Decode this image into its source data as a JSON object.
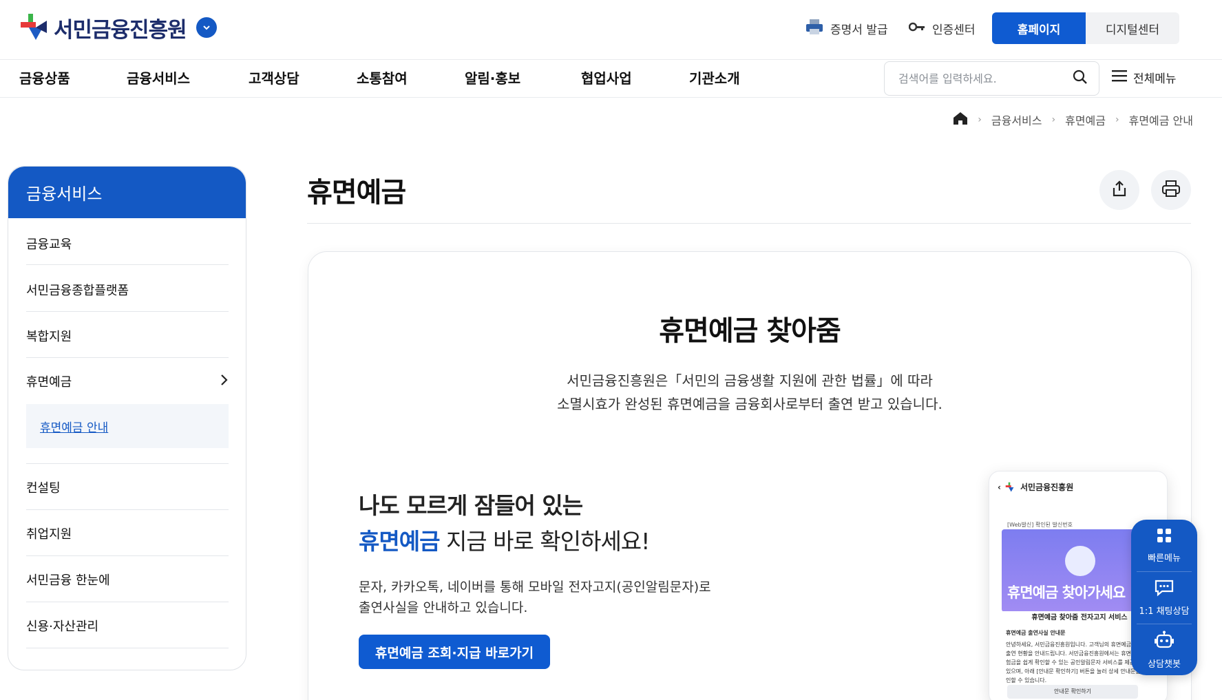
{
  "header": {
    "logo_text": "서민금융진흥원",
    "utilities": [
      {
        "label": "증명서 발급",
        "icon": "printer-icon"
      },
      {
        "label": "인증센터",
        "icon": "key-icon"
      }
    ],
    "home_button": "홈페이지",
    "digital_button": "디지털센터"
  },
  "nav": {
    "items": [
      "금융상품",
      "금융서비스",
      "고객상담",
      "소통참여",
      "알림·홍보",
      "협업사업",
      "기관소개"
    ],
    "search_placeholder": "검색어를 입력하세요.",
    "all_menu": "전체메뉴"
  },
  "breadcrumb": [
    "금융서비스",
    "휴면예금",
    "휴면예금 안내"
  ],
  "sidebar": {
    "title": "금융서비스",
    "items": [
      "금융교육",
      "서민금융종합플랫폼",
      "복합지원",
      "휴면예금",
      "컨설팅",
      "취업지원",
      "서민금융 한눈에",
      "신용·자산관리"
    ],
    "sub_item": "휴면예금 안내"
  },
  "main": {
    "title": "휴면예금",
    "hero_title": "휴면예금 찾아줌",
    "hero_desc_line1": "서민금융진흥원은「서민의 금융생활 지원에 관한 법률」에 따라",
    "hero_desc_line2": "소멸시효가 완성된 휴면예금을 금융회사로부터 출연 받고 있습니다.",
    "promo_line1": "나도 모르게 잠들어 있는",
    "promo_highlight": "휴면예금",
    "promo_line2_rest": " 지금 바로 확인하세요!",
    "promo_desc_line1": "문자, 카카오톡, 네이버를 통해 모바일 전자고지(공인알림문자)로",
    "promo_desc_line2": "출연사실을 안내하고 있습니다.",
    "cta": "휴면예금 조회·지급 바로가기"
  },
  "phone": {
    "app_title": "서민금융진흥원",
    "sub_label": "[Web발신] 확인된 발신번호",
    "banner_title": "휴면예금 찾아가세요",
    "banner_sub": "휴면예금 찾아줌 전자고지 서비스",
    "notice_title": "휴면예금 출연사실 안내문",
    "notice_body": "안녕하세요, 서민금융진흥원입니다. 고객님의 휴면예금·보험금 출연 현황을 안내드립니다. 서민금융진흥원에서는 휴면예금·보험금을 쉽게 확인할 수 있는 공인알림문자 서비스를 제공하고 있으며, 아래 [안내문 확인하기] 버튼을 눌러 상세 안내문을 확인할 수 있습니다.",
    "button": "안내문 확인하기"
  },
  "quick_menu": [
    {
      "label": "빠른메뉴",
      "icon": "grid-icon"
    },
    {
      "label": "1:1 채팅상담",
      "icon": "chat-icon"
    },
    {
      "label": "상담챗봇",
      "icon": "robot-icon"
    }
  ],
  "colors": {
    "primary": "#1459c4",
    "brand_navy": "#1d2d6b",
    "cta": "#0f5bd1"
  }
}
